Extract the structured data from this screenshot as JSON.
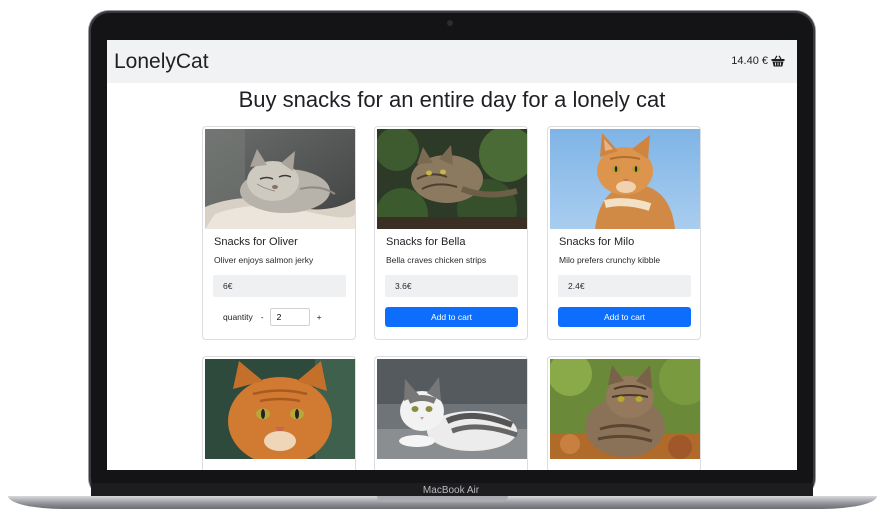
{
  "laptop": {
    "model": "MacBook Air"
  },
  "navbar": {
    "brand": "LonelyCat",
    "cart_total": "14.40 €"
  },
  "page": {
    "title": "Buy snacks for an entire day for a lonely cat"
  },
  "products": [
    {
      "title": "Snacks for Oliver",
      "description": "Oliver enjoys salmon jerky",
      "price": "6€",
      "quantity_label": "quantity",
      "quantity_value": "2",
      "minus": "-",
      "plus": "+"
    },
    {
      "title": "Snacks for Bella",
      "description": "Bella craves chicken strips",
      "price": "3.6€",
      "button": "Add to cart"
    },
    {
      "title": "Snacks for Milo",
      "description": "Milo prefers crunchy kibble",
      "price": "2.4€",
      "button": "Add to cart"
    }
  ],
  "colors": {
    "primary": "#0d6efd",
    "navbar_bg": "#f1f2f4",
    "price_bg": "#eff0f2"
  }
}
